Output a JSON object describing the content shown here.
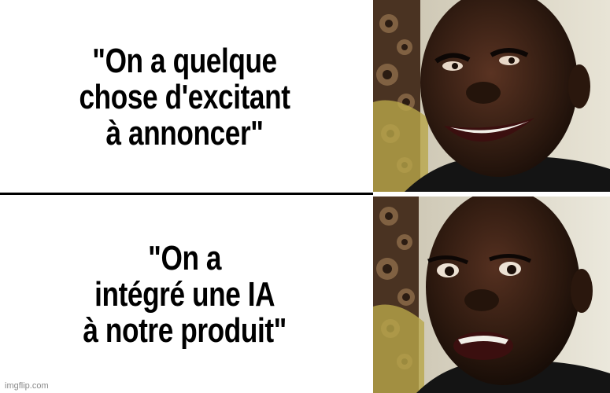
{
  "panels": [
    {
      "caption": "\"On a quelque\nchose d'excitant\nà annoncer\""
    },
    {
      "caption": "\"On a\nintégré une IA\nà notre produit\""
    }
  ],
  "watermark": "imgflip.com"
}
